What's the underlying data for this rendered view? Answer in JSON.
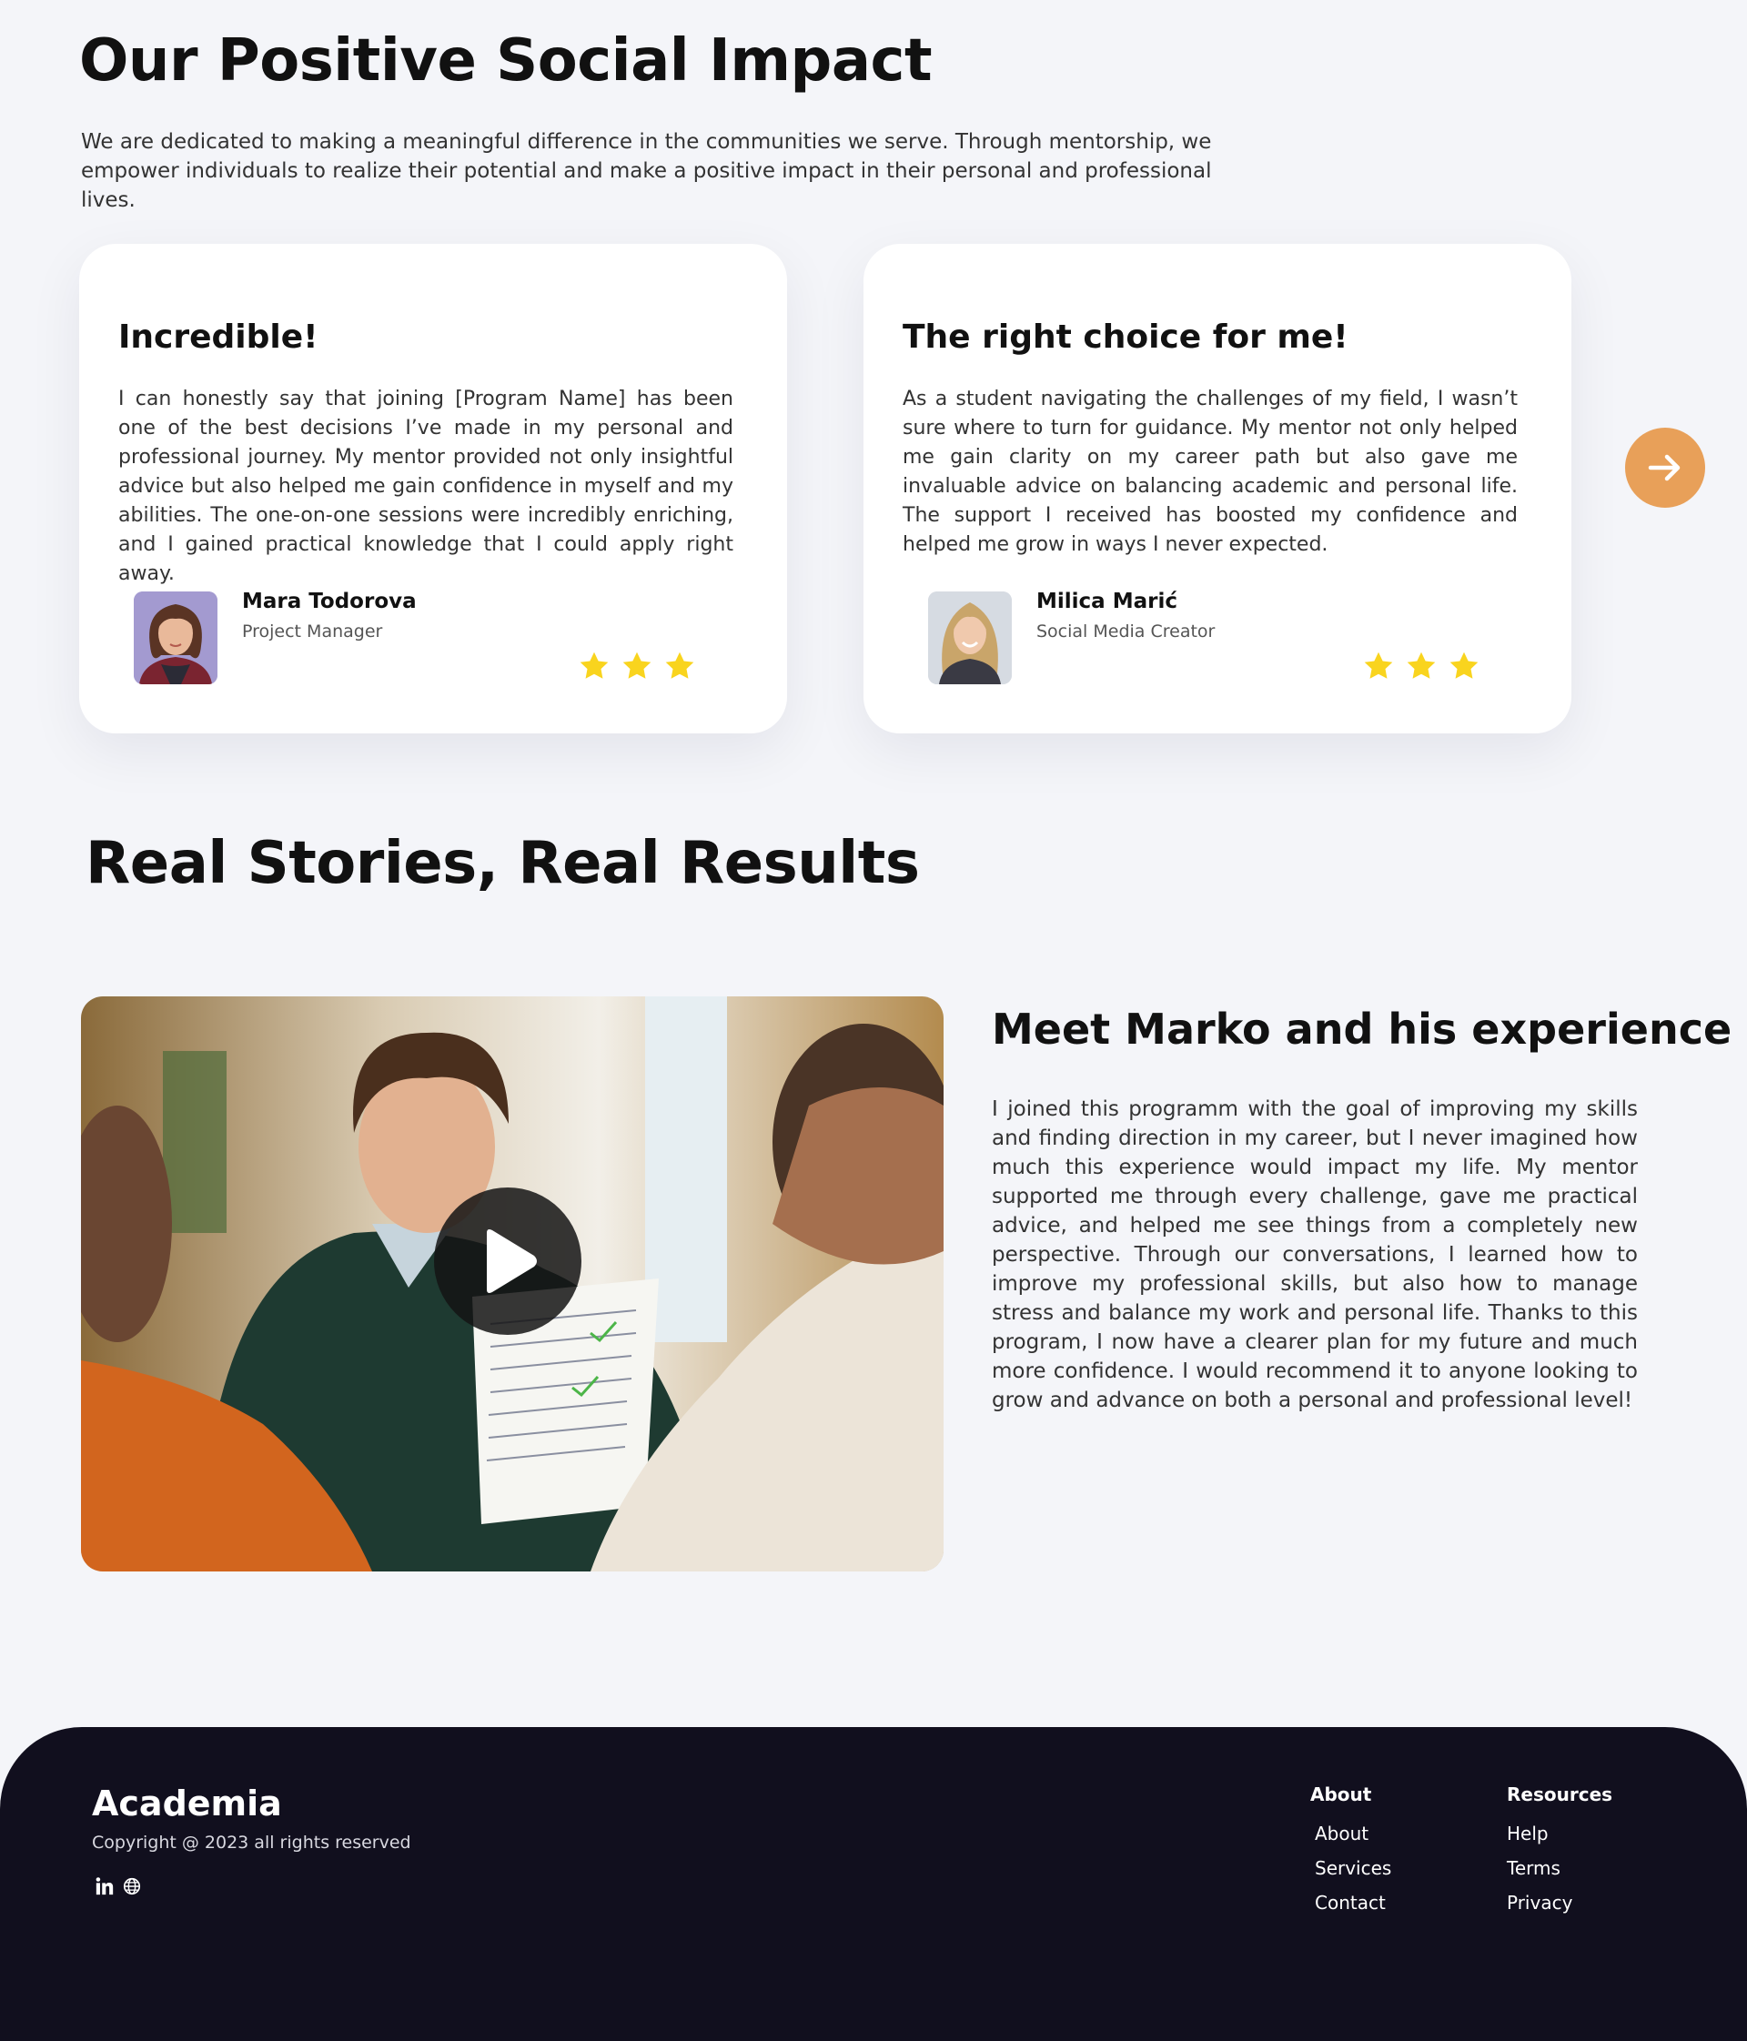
{
  "impact": {
    "title": "Our Positive Social Impact",
    "description": "We are dedicated to making a meaningful difference in the communities we serve. Through mentorship, we empower individuals to realize their potential and make a positive impact in their personal and professional lives."
  },
  "testimonials": [
    {
      "title": "Incredible!",
      "body": "I can honestly say that joining [Program Name] has been one of the best decisions I’ve made in my personal and professional journey. My mentor provided not only insightful advice but also helped me gain confidence in myself and my abilities. The one-on-one sessions were incredibly enriching, and I gained practical knowledge that I could apply right away.",
      "name": "Mara Todorova",
      "role": "Project Manager",
      "rating": 3
    },
    {
      "title": "The right choice for me!",
      "body": "As a student navigating the challenges of my field, I wasn’t sure where to turn for guidance. My mentor not only helped me gain clarity on my career path but also gave me invaluable advice on balancing academic and personal life. The support I received has boosted my confidence and helped me grow in ways I never expected.",
      "name": "Milica Marić",
      "role": "Social Media Creator",
      "rating": 3
    }
  ],
  "stories": {
    "title": "Real Stories, Real Results",
    "story_title": "Meet Marko and his experience",
    "story_body": "I joined this programm with the goal of improving my skills and finding direction in my career, but I never imagined how much this experience would impact my life. My mentor supported me through every challenge, gave me practical advice, and helped me see things from a completely new perspective. Through our conversations, I learned how to improve my professional skills, but also how to manage stress and balance my work and personal life. Thanks to this program, I now have a clearer plan for my future and much more confidence. I would recommend it to anyone looking to grow and advance on both a personal and professional level!"
  },
  "footer": {
    "brand": "Academia",
    "copyright": "Copyright @ 2023 all rights reserved",
    "socials": [
      "linkedin-icon",
      "globe-icon"
    ],
    "columns": [
      {
        "heading": "About",
        "links": [
          "About",
          "Services",
          "Contact"
        ]
      },
      {
        "heading": "Resources",
        "links": [
          "Help",
          "Terms",
          "Privacy"
        ]
      }
    ]
  },
  "colors": {
    "background": "#f4f5f9",
    "accent": "#e8a059",
    "star": "#f9d41e",
    "footer": "#110f1e"
  }
}
